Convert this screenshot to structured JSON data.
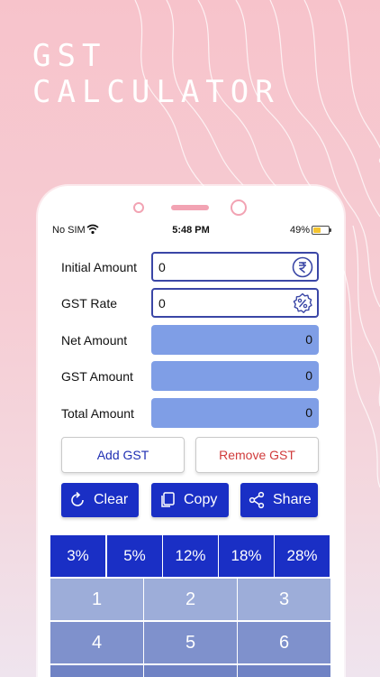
{
  "headline": {
    "line1": "GST",
    "line2": "CALCULATOR"
  },
  "status_bar": {
    "carrier": "No SIM",
    "time": "5:48 PM",
    "battery": "49%",
    "battery_level": 0.49
  },
  "fields": [
    {
      "label": "Initial Amount",
      "value": "0",
      "type": "input",
      "icon": "rupee-icon"
    },
    {
      "label": "GST Rate",
      "value": "0",
      "type": "input",
      "icon": "percent-badge-icon"
    },
    {
      "label": "Net Amount",
      "value": "0",
      "type": "output"
    },
    {
      "label": "GST Amount",
      "value": "0",
      "type": "output"
    },
    {
      "label": "Total Amount",
      "value": "0",
      "type": "output"
    }
  ],
  "actions": {
    "add_gst": "Add GST",
    "remove_gst": "Remove GST"
  },
  "tools": {
    "clear": "Clear",
    "copy": "Copy",
    "share": "Share"
  },
  "rates": [
    "3%",
    "5%",
    "12%",
    "18%",
    "28%"
  ],
  "keys": [
    "1",
    "2",
    "3",
    "4",
    "5",
    "6"
  ],
  "colors": {
    "primary": "#1a2fc5",
    "output_fill": "#7f9ee6",
    "input_border": "#3a46a6",
    "remove": "#d03b3b",
    "background": "#f7c3cb"
  }
}
